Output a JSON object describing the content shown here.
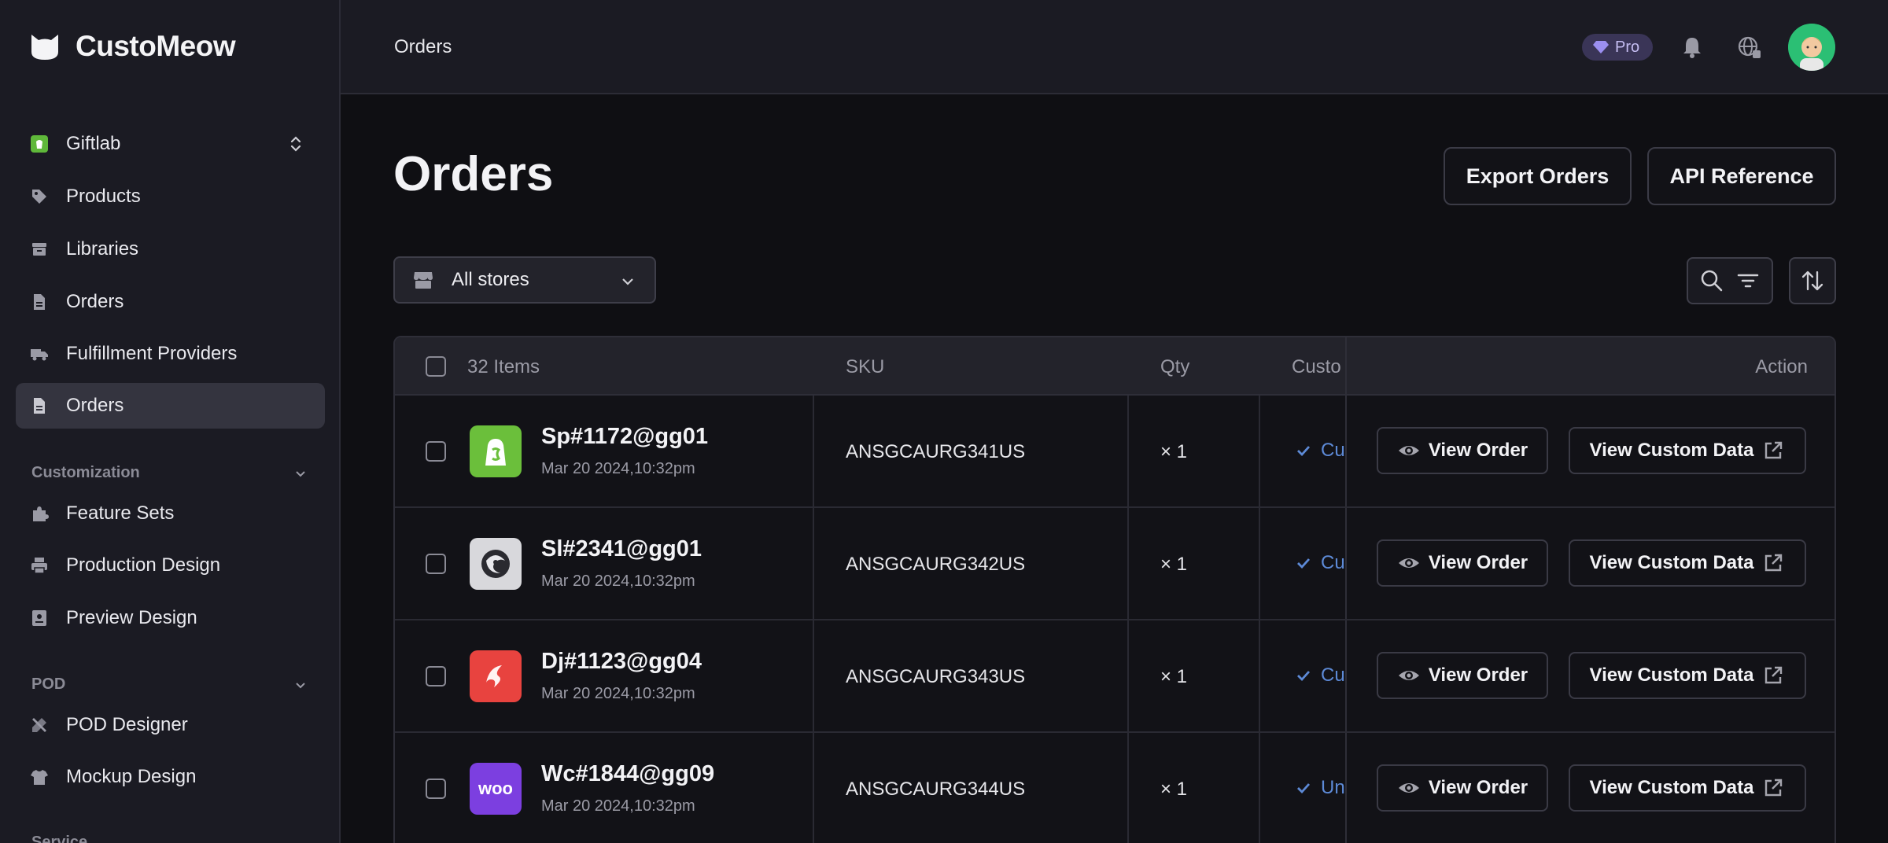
{
  "brand": {
    "name": "CustoMeow"
  },
  "sidebar": {
    "store_switcher": {
      "label": "Giftlab"
    },
    "items": [
      {
        "label": "Products"
      },
      {
        "label": "Libraries"
      },
      {
        "label": "Orders"
      },
      {
        "label": "Fulfillment Providers"
      },
      {
        "label": "Orders"
      }
    ],
    "sections": [
      {
        "title": "Customization",
        "items": [
          {
            "label": "Feature Sets"
          },
          {
            "label": "Production Design"
          },
          {
            "label": "Preview Design"
          }
        ]
      },
      {
        "title": "POD",
        "items": [
          {
            "label": "POD Designer"
          },
          {
            "label": "Mockup Design"
          }
        ]
      },
      {
        "title": "Service"
      }
    ]
  },
  "header": {
    "breadcrumb": "Orders",
    "plan_badge": "Pro"
  },
  "main": {
    "title": "Orders",
    "export_label": "Export Orders",
    "api_label": "API Reference",
    "store_filter": "All stores"
  },
  "table": {
    "item_count": "32 Items",
    "columns": {
      "sku": "SKU",
      "qty": "Qty",
      "custom": "Custo",
      "action": "Action"
    },
    "view_order_label": "View Order",
    "view_custom_label": "View Custom Data",
    "rows": [
      {
        "id": "Sp#1172@gg01",
        "date": "Mar 20 2024,10:32pm",
        "sku": "ANSGCAURG341US",
        "qty": "× 1",
        "status": "Cu",
        "store": "shopify"
      },
      {
        "id": "Sl#2341@gg01",
        "date": "Mar 20 2024,10:32pm",
        "sku": "ANSGCAURG342US",
        "qty": "× 1",
        "status": "Cu",
        "store": "shopline"
      },
      {
        "id": "Dj#1123@gg04",
        "date": "Mar 20 2024,10:32pm",
        "sku": "ANSGCAURG343US",
        "qty": "× 1",
        "status": "Cu",
        "store": "dajiang"
      },
      {
        "id": "Wc#1844@gg09",
        "date": "Mar 20 2024,10:32pm",
        "sku": "ANSGCAURG344US",
        "qty": "× 1",
        "status": "Un",
        "store": "woocommerce"
      }
    ]
  },
  "colors": {
    "accent": "#5d8ad7",
    "active_nav": "#34343f",
    "pro_badge": "#3a3557"
  }
}
